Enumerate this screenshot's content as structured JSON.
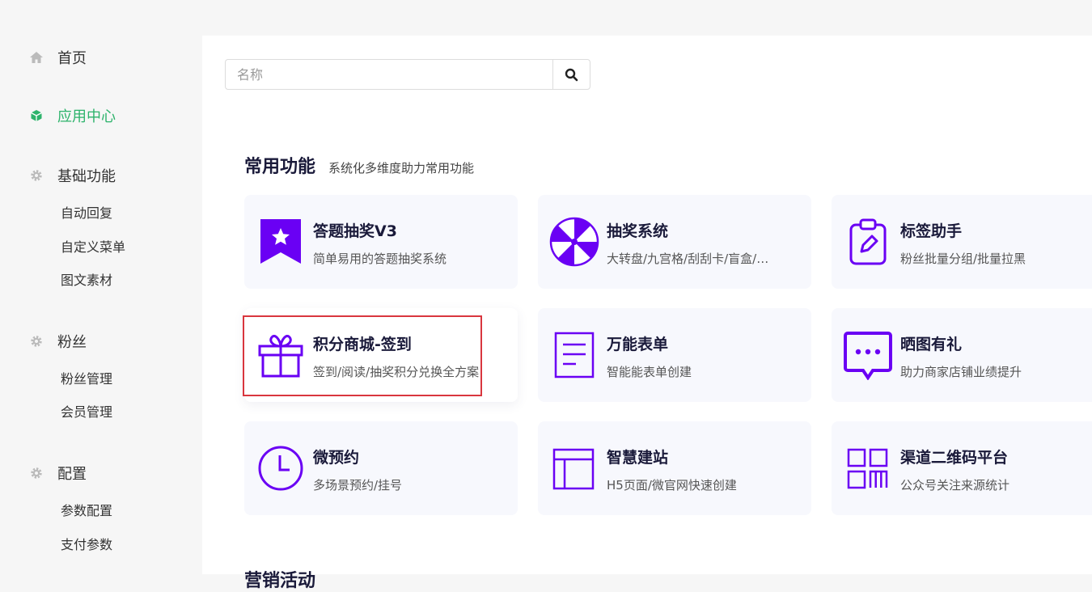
{
  "sidebar": {
    "home": "首页",
    "app_center": "应用中心",
    "basic": {
      "label": "基础功能",
      "items": [
        "自动回复",
        "自定义菜单",
        "图文素材"
      ]
    },
    "fans": {
      "label": "粉丝",
      "items": [
        "粉丝管理",
        "会员管理"
      ]
    },
    "config": {
      "label": "配置",
      "items": [
        "参数配置",
        "支付参数"
      ]
    }
  },
  "search": {
    "placeholder": "名称",
    "value": ""
  },
  "section": {
    "title": "常用功能",
    "subtitle": "系统化多维度助力常用功能"
  },
  "next_section_title": "营销活动",
  "apps": [
    {
      "title": "答题抽奖V3",
      "desc": "简单易用的答题抽奖系统",
      "icon": "ribbon-star-icon"
    },
    {
      "title": "抽奖系统",
      "desc": "大转盘/九宫格/刮刮卡/盲盒/…",
      "icon": "wheel-icon"
    },
    {
      "title": "标签助手",
      "desc": "粉丝批量分组/批量拉黑",
      "icon": "clipboard-tag-icon"
    },
    {
      "title": "积分商城-签到",
      "desc": "签到/阅读/抽奖积分兑换全方案",
      "icon": "gift-icon"
    },
    {
      "title": "万能表单",
      "desc": "智能能表单创建",
      "icon": "form-icon"
    },
    {
      "title": "晒图有礼",
      "desc": "助力商家店铺业绩提升",
      "icon": "chat-bubble-icon"
    },
    {
      "title": "微预约",
      "desc": "多场景预约/挂号",
      "icon": "clock-icon"
    },
    {
      "title": "智慧建站",
      "desc": "H5页面/微官网快速创建",
      "icon": "layout-icon"
    },
    {
      "title": "渠道二维码平台",
      "desc": "公众号关注来源统计",
      "icon": "qr-grid-icon"
    }
  ],
  "colors": {
    "accent": "#2db36b",
    "icon_purple": "#6a00f4",
    "highlight_border": "#d9363e"
  }
}
